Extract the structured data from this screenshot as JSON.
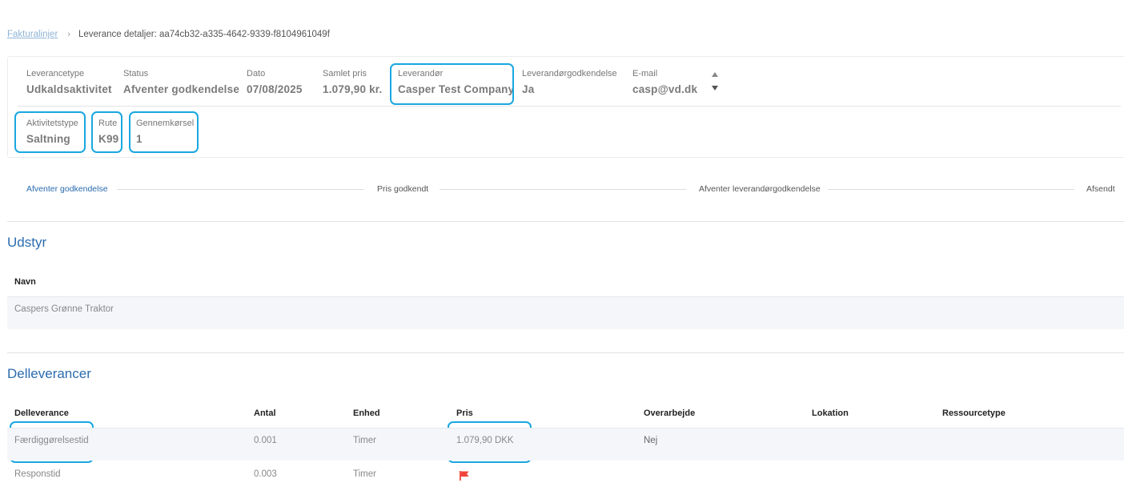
{
  "breadcrumb": {
    "link": "Fakturalinjer",
    "current": "Leverance detaljer: aa74cb32-a335-4642-9339-f8104961049f"
  },
  "summary": {
    "leverancetype": {
      "label": "Leverancetype",
      "value": "Udkaldsaktivitet"
    },
    "status": {
      "label": "Status",
      "value": "Afventer godkendelse"
    },
    "dato": {
      "label": "Dato",
      "value": "07/08/2025"
    },
    "samlet_pris": {
      "label": "Samlet pris",
      "value": "1.079,90 kr."
    },
    "leverandor": {
      "label": "Leverandør",
      "value": "Casper Test Company"
    },
    "leverandor_godkendelse": {
      "label": "Leverandørgodkendelse",
      "value": "Ja"
    },
    "email": {
      "label": "E-mail",
      "value": "casp@vd.dk"
    },
    "aktivitetstype": {
      "label": "Aktivitetstype",
      "value": "Saltning"
    },
    "rute": {
      "label": "Rute",
      "value": "K99"
    },
    "gennemkorsel": {
      "label": "Gennemkørsel",
      "value": "1"
    }
  },
  "stepper": {
    "steps": [
      "Afventer godkendelse",
      "Pris godkendt",
      "Afventer leverandørgodkendelse",
      "Afsendt"
    ],
    "active_index": 0
  },
  "udstyr": {
    "title": "Udstyr",
    "columns": [
      "Navn"
    ],
    "rows": [
      [
        "Caspers Grønne Traktor"
      ]
    ]
  },
  "delleverancer": {
    "title": "Delleverancer",
    "columns": [
      "Delleverance",
      "Antal",
      "Enhed",
      "Pris",
      "Overarbejde",
      "Lokation",
      "Ressourcetype"
    ],
    "rows": [
      {
        "delleverance": "Færdiggørelsestid",
        "antal": "0.001",
        "enhed": "Timer",
        "pris": "1.079,90 DKK",
        "overarbejde": "Nej",
        "lokation": "",
        "ressourcetype": ""
      },
      {
        "delleverance": "Responstid",
        "antal": "0.003",
        "enhed": "Timer",
        "pris_icon": "flag-icon",
        "overarbejde": "",
        "lokation": "",
        "ressourcetype": ""
      }
    ]
  },
  "colors": {
    "accent": "#2b6cb0",
    "highlight": "#1aa7e0",
    "flag": "#f0443a"
  }
}
